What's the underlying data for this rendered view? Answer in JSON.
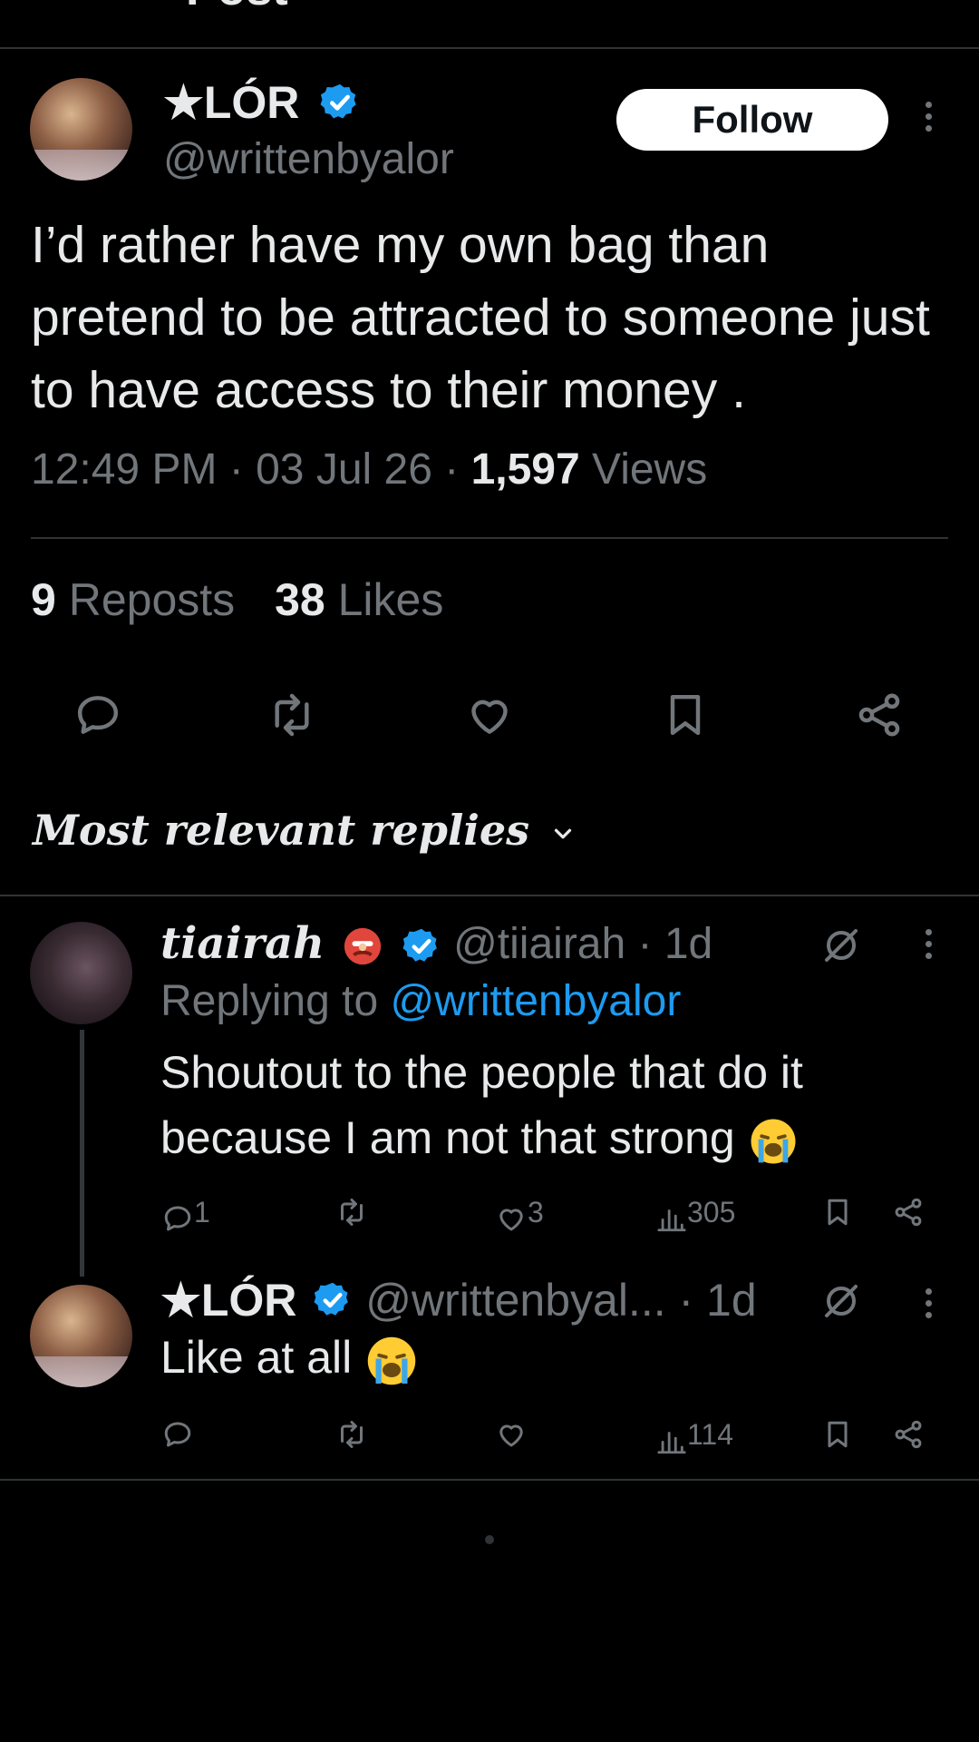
{
  "header": {
    "title": "Post"
  },
  "post": {
    "author_name": "★LÓR",
    "author_handle": "@writtenbyalor",
    "follow_label": "Follow",
    "text": "I’d rather have my own bag than pretend to be attracted to someone just to have access to their money .",
    "time": "12:49 PM",
    "date": "03 Jul 26",
    "views_count": "1,597",
    "views_label": "Views",
    "reposts_count": "9",
    "reposts_label": "Reposts",
    "likes_count": "38",
    "likes_label": "Likes"
  },
  "replies_filter": {
    "label": "Most relevant replies"
  },
  "replies": [
    {
      "author_name": "tiairah",
      "author_handle": "@tiiairah",
      "age": "1d",
      "replying_prefix": "Replying to",
      "replying_to": "@writtenbyalor",
      "text_line1": "Shoutout to the people that do it",
      "text_line2": "because I am not that strong",
      "reply_count": "1",
      "like_count": "3",
      "view_count": "305"
    },
    {
      "author_name": "★LÓR",
      "author_handle": "@writtenbyal...",
      "age": "1d",
      "text": "Like at all",
      "view_count": "114"
    }
  ],
  "colors": {
    "background": "#000000",
    "text": "#e7e9ea",
    "muted": "#71767b",
    "link": "#1d9bf0",
    "verified": "#1d9bf0"
  },
  "icons": [
    "reply-icon",
    "repost-icon",
    "like-icon",
    "bookmark-icon",
    "share-icon",
    "views-icon",
    "verified-badge-icon",
    "grok-icon",
    "more-icon",
    "chevron-down-icon"
  ]
}
